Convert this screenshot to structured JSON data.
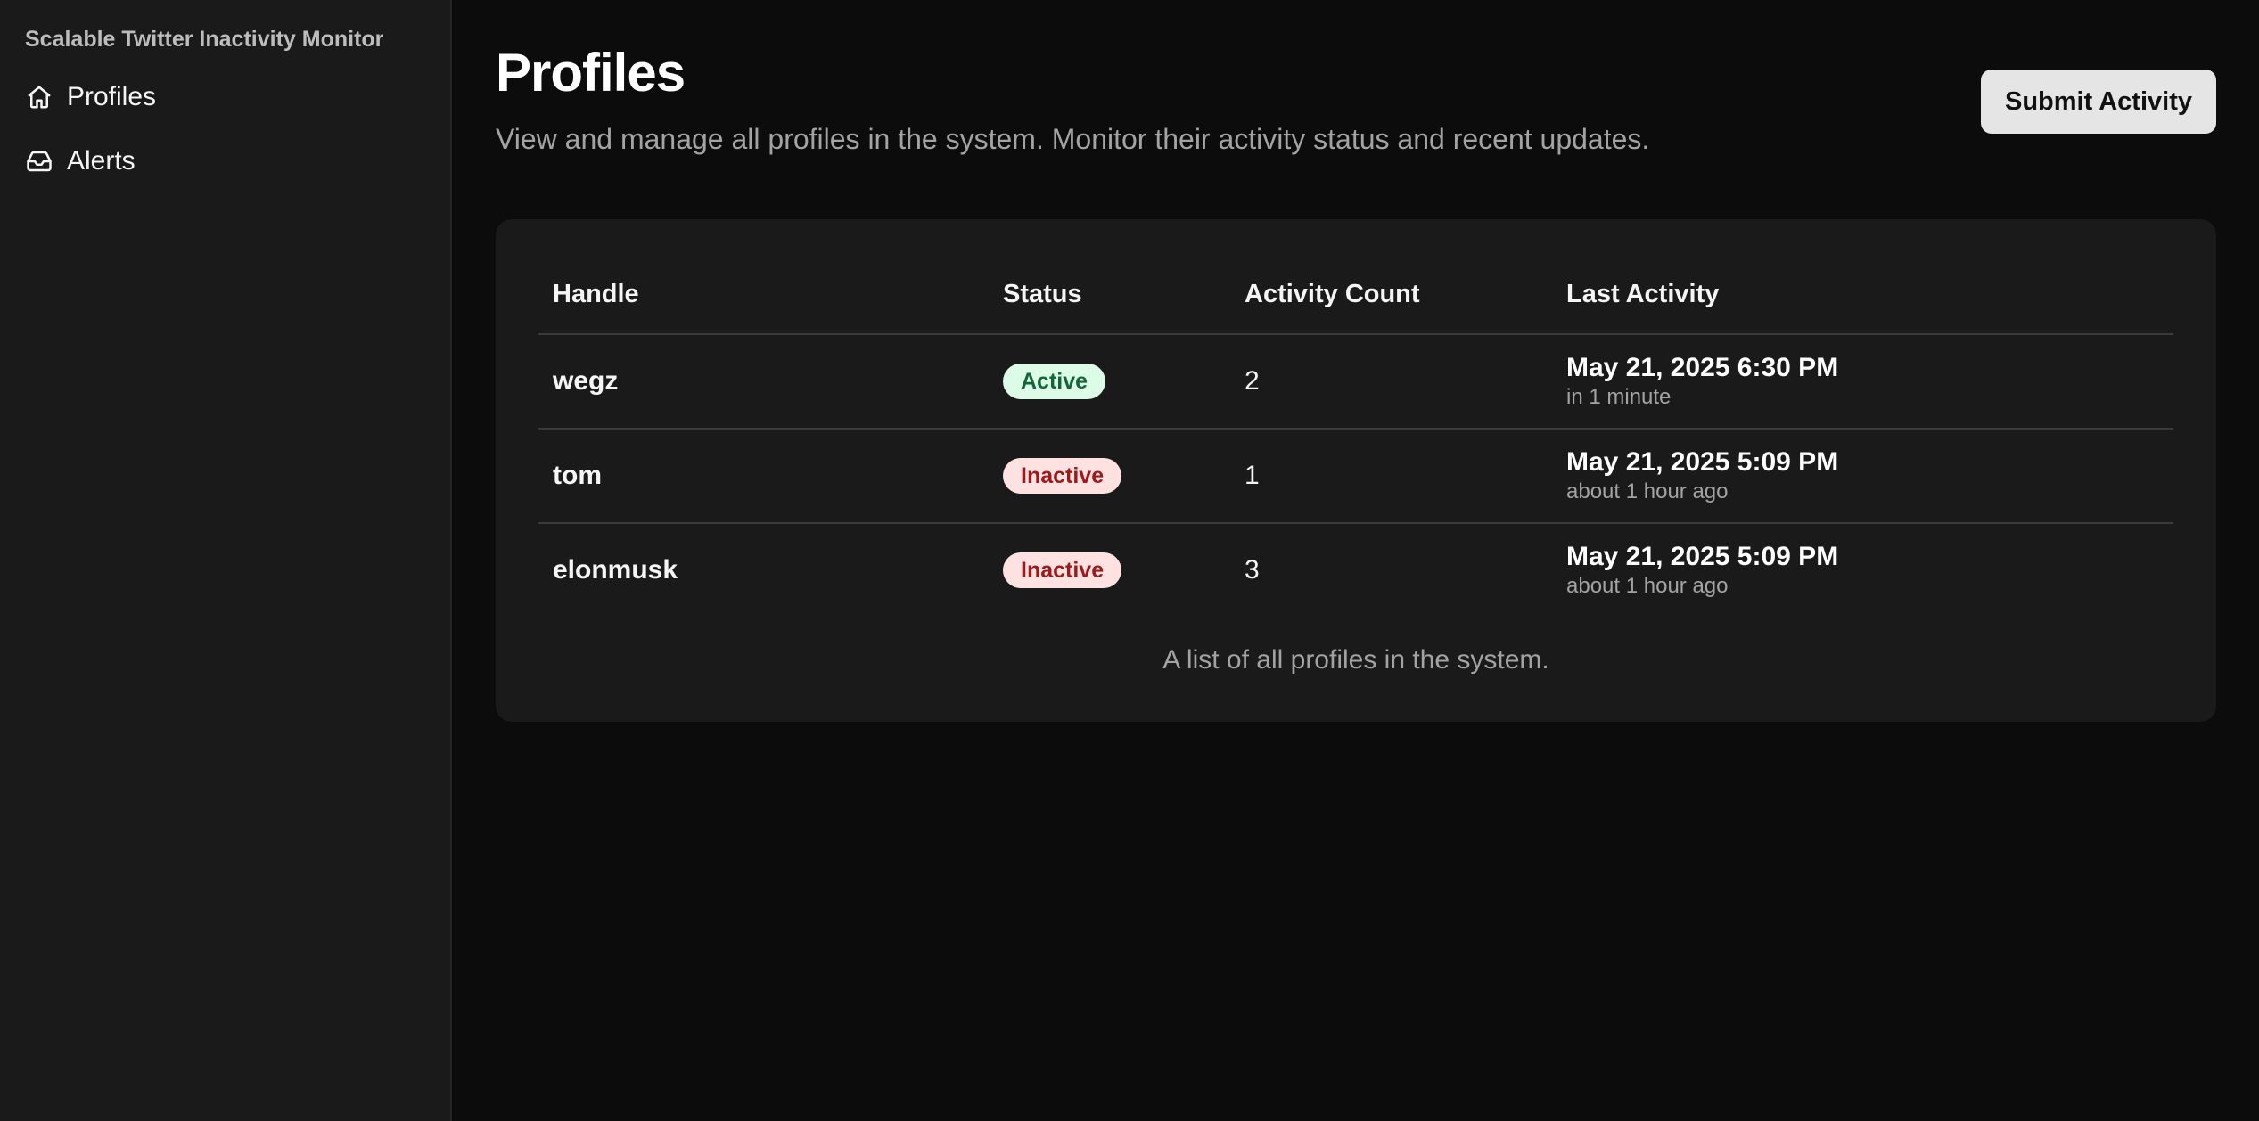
{
  "app_title": "Scalable Twitter Inactivity Monitor",
  "sidebar": {
    "items": [
      {
        "label": "Profiles",
        "icon": "home-icon"
      },
      {
        "label": "Alerts",
        "icon": "inbox-icon"
      }
    ]
  },
  "header": {
    "title": "Profiles",
    "subtitle": "View and manage all profiles in the system. Monitor their activity status and recent updates.",
    "submit_label": "Submit Activity"
  },
  "table": {
    "columns": [
      "Handle",
      "Status",
      "Activity Count",
      "Last Activity"
    ],
    "rows": [
      {
        "handle": "wegz",
        "status": "Active",
        "count": "2",
        "last_activity": "May 21, 2025 6:30 PM",
        "relative": "in 1 minute"
      },
      {
        "handle": "tom",
        "status": "Inactive",
        "count": "1",
        "last_activity": "May 21, 2025 5:09 PM",
        "relative": "about 1 hour ago"
      },
      {
        "handle": "elonmusk",
        "status": "Inactive",
        "count": "3",
        "last_activity": "May 21, 2025 5:09 PM",
        "relative": "about 1 hour ago"
      }
    ],
    "caption": "A list of all profiles in the system."
  },
  "colors": {
    "background": "#0c0c0c",
    "sidebar": "#1a1a1a",
    "card": "#1a1a1a",
    "active_badge_bg": "#dcfce7",
    "active_badge_text": "#15653a",
    "inactive_badge_bg": "#fee2e2",
    "inactive_badge_text": "#991b1b"
  }
}
